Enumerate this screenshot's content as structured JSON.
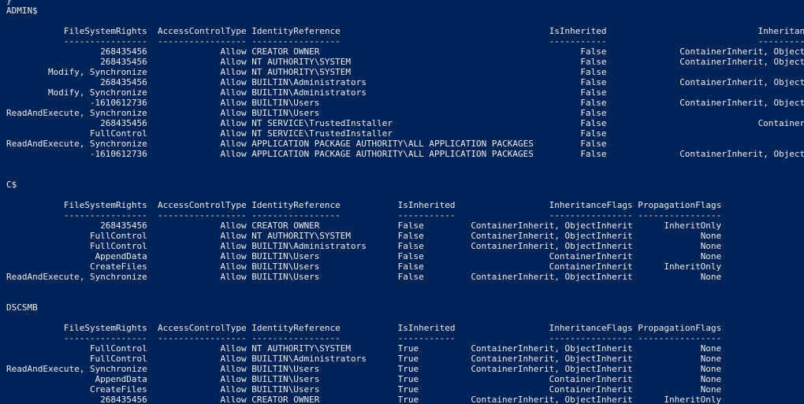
{
  "window": {
    "title": ""
  },
  "prompt_tail": "}",
  "sections": [
    {
      "name": "ADMIN$",
      "layout": "admin",
      "headers": [
        "FileSystemRights",
        "AccessControlType",
        "IdentityReference",
        "IsInherited",
        "InheritanceF"
      ],
      "separators": [
        "----------------",
        "-----------------",
        "-----------------",
        "-----------",
        "------------"
      ],
      "rows": [
        [
          "268435456",
          "Allow",
          "CREATOR OWNER",
          "False",
          "ContainerInherit, ObjectInh"
        ],
        [
          "268435456",
          "Allow",
          "NT AUTHORITY\\SYSTEM",
          "False",
          "ContainerInherit, ObjectInh"
        ],
        [
          "Modify, Synchronize",
          "Allow",
          "NT AUTHORITY\\SYSTEM",
          "False",
          ""
        ],
        [
          "268435456",
          "Allow",
          "BUILTIN\\Administrators",
          "False",
          "ContainerInherit, ObjectInh"
        ],
        [
          "Modify, Synchronize",
          "Allow",
          "BUILTIN\\Administrators",
          "False",
          ""
        ],
        [
          "-1610612736",
          "Allow",
          "BUILTIN\\Users",
          "False",
          "ContainerInherit, ObjectInh"
        ],
        [
          "ReadAndExecute, Synchronize",
          "Allow",
          "BUILTIN\\Users",
          "False",
          ""
        ],
        [
          "268435456",
          "Allow",
          "NT SERVICE\\TrustedInstaller",
          "False",
          "ContainerInh"
        ],
        [
          "FullControl",
          "Allow",
          "NT SERVICE\\TrustedInstaller",
          "False",
          ""
        ],
        [
          "ReadAndExecute, Synchronize",
          "Allow",
          "APPLICATION PACKAGE AUTHORITY\\ALL APPLICATION PACKAGES",
          "False",
          ""
        ],
        [
          "-1610612736",
          "Allow",
          "APPLICATION PACKAGE AUTHORITY\\ALL APPLICATION PACKAGES",
          "False",
          "ContainerInherit, ObjectInh"
        ]
      ]
    },
    {
      "name": "C$",
      "layout": "std",
      "headers": [
        "FileSystemRights",
        "AccessControlType",
        "IdentityReference",
        "IsInherited",
        "InheritanceFlags",
        "PropagationFlags"
      ],
      "separators": [
        "----------------",
        "-----------------",
        "-----------------",
        "-----------",
        "----------------",
        "----------------"
      ],
      "rows": [
        [
          "268435456",
          "Allow",
          "CREATOR OWNER",
          "False",
          "ContainerInherit, ObjectInherit",
          "InheritOnly"
        ],
        [
          "FullControl",
          "Allow",
          "NT AUTHORITY\\SYSTEM",
          "False",
          "ContainerInherit, ObjectInherit",
          "None"
        ],
        [
          "FullControl",
          "Allow",
          "BUILTIN\\Administrators",
          "False",
          "ContainerInherit, ObjectInherit",
          "None"
        ],
        [
          "AppendData",
          "Allow",
          "BUILTIN\\Users",
          "False",
          "ContainerInherit",
          "None"
        ],
        [
          "CreateFiles",
          "Allow",
          "BUILTIN\\Users",
          "False",
          "ContainerInherit",
          "InheritOnly"
        ],
        [
          "ReadAndExecute, Synchronize",
          "Allow",
          "BUILTIN\\Users",
          "False",
          "ContainerInherit, ObjectInherit",
          "None"
        ]
      ]
    },
    {
      "name": "DSCSMB",
      "layout": "std",
      "headers": [
        "FileSystemRights",
        "AccessControlType",
        "IdentityReference",
        "IsInherited",
        "InheritanceFlags",
        "PropagationFlags"
      ],
      "separators": [
        "----------------",
        "-----------------",
        "-----------------",
        "-----------",
        "----------------",
        "----------------"
      ],
      "rows": [
        [
          "FullControl",
          "Allow",
          "NT AUTHORITY\\SYSTEM",
          "True",
          "ContainerInherit, ObjectInherit",
          "None"
        ],
        [
          "FullControl",
          "Allow",
          "BUILTIN\\Administrators",
          "True",
          "ContainerInherit, ObjectInherit",
          "None"
        ],
        [
          "ReadAndExecute, Synchronize",
          "Allow",
          "BUILTIN\\Users",
          "True",
          "ContainerInherit, ObjectInherit",
          "None"
        ],
        [
          "AppendData",
          "Allow",
          "BUILTIN\\Users",
          "True",
          "ContainerInherit",
          "None"
        ],
        [
          "CreateFiles",
          "Allow",
          "BUILTIN\\Users",
          "True",
          "ContainerInherit",
          "None"
        ],
        [
          "268435456",
          "Allow",
          "CREATOR OWNER",
          "True",
          "ContainerInherit, ObjectInherit",
          "InheritOnly"
        ]
      ]
    }
  ]
}
